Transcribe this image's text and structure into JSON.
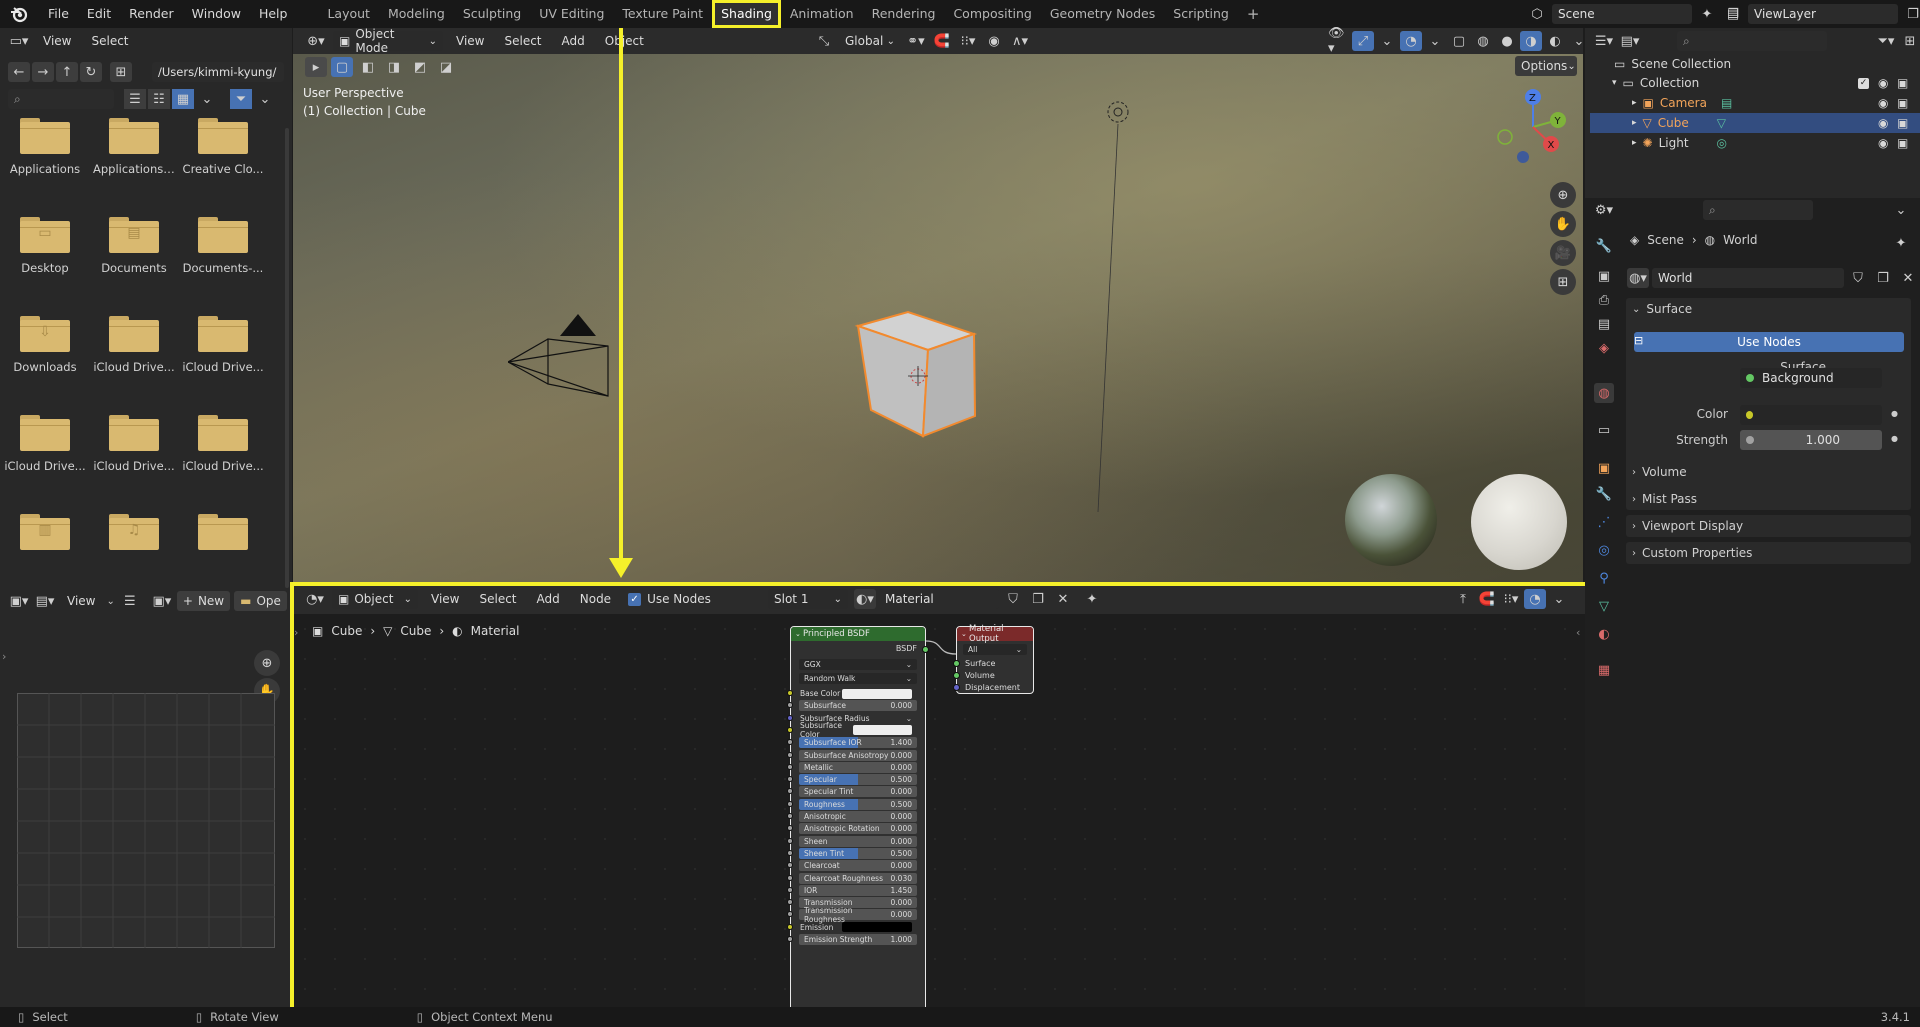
{
  "topbar": {
    "menus": [
      "File",
      "Edit",
      "Render",
      "Window",
      "Help"
    ],
    "workspaces": [
      "Layout",
      "Modeling",
      "Sculpting",
      "UV Editing",
      "Texture Paint",
      "Shading",
      "Animation",
      "Rendering",
      "Compositing",
      "Geometry Nodes",
      "Scripting"
    ],
    "active_workspace": "Shading",
    "add_tab": "+",
    "scene_name": "Scene",
    "view_layer": "ViewLayer"
  },
  "file_browser": {
    "menus": [
      "View",
      "Select"
    ],
    "path": "/Users/kimmi-kyung/",
    "items": [
      {
        "label": "Applications",
        "icon": "folder-icon"
      },
      {
        "label": "Applications ...",
        "icon": "folder-icon"
      },
      {
        "label": "Creative Clo...",
        "icon": "folder-icon"
      },
      {
        "label": "Desktop",
        "icon": "folder-desktop-icon"
      },
      {
        "label": "Documents",
        "icon": "folder-documents-icon"
      },
      {
        "label": "Documents-...",
        "icon": "folder-icon"
      },
      {
        "label": "Downloads",
        "icon": "folder-downloads-icon"
      },
      {
        "label": "iCloud Drive...",
        "icon": "folder-icon"
      },
      {
        "label": "iCloud Drive...",
        "icon": "folder-icon"
      },
      {
        "label": "iCloud Drive...",
        "icon": "folder-icon"
      },
      {
        "label": "iCloud Drive...",
        "icon": "folder-icon"
      },
      {
        "label": "iCloud Drive...",
        "icon": "folder-icon"
      },
      {
        "label": "",
        "icon": "folder-movies-icon"
      },
      {
        "label": "",
        "icon": "folder-music-icon"
      },
      {
        "label": "",
        "icon": "folder-icon"
      }
    ]
  },
  "image_editor": {
    "view": "View",
    "new": "New",
    "open": "Ope"
  },
  "viewport": {
    "mode": "Object Mode",
    "menus": [
      "View",
      "Select",
      "Add",
      "Object"
    ],
    "orientation": "Global",
    "options": "Options",
    "perspective_label": "User Perspective",
    "collection_label": "(1) Collection | Cube",
    "gizmo_axes": [
      "Z",
      "Y",
      "X"
    ]
  },
  "node_editor": {
    "type": "Object",
    "menus": [
      "View",
      "Select",
      "Add",
      "Node"
    ],
    "use_nodes": "Use Nodes",
    "slot": "Slot 1",
    "material": "Material",
    "breadcrumb": [
      "Cube",
      "Cube",
      "Material"
    ],
    "principled": {
      "title": "Principled BSDF",
      "output": "BSDF",
      "distribution": "GGX",
      "subsurface_method": "Random Walk",
      "rows": [
        {
          "label": "Base Color",
          "value": "",
          "kind": "color"
        },
        {
          "label": "Subsurface",
          "value": "0.000",
          "kind": "num"
        },
        {
          "label": "Subsurface Radius",
          "value": "",
          "kind": "vec"
        },
        {
          "label": "Subsurface Color",
          "value": "",
          "kind": "color"
        },
        {
          "label": "Subsurface IOR",
          "value": "1.400",
          "kind": "blue"
        },
        {
          "label": "Subsurface Anisotropy",
          "value": "0.000",
          "kind": "num"
        },
        {
          "label": "Metallic",
          "value": "0.000",
          "kind": "num"
        },
        {
          "label": "Specular",
          "value": "0.500",
          "kind": "blue"
        },
        {
          "label": "Specular Tint",
          "value": "0.000",
          "kind": "num"
        },
        {
          "label": "Roughness",
          "value": "0.500",
          "kind": "blue"
        },
        {
          "label": "Anisotropic",
          "value": "0.000",
          "kind": "num"
        },
        {
          "label": "Anisotropic Rotation",
          "value": "0.000",
          "kind": "num"
        },
        {
          "label": "Sheen",
          "value": "0.000",
          "kind": "num"
        },
        {
          "label": "Sheen Tint",
          "value": "0.500",
          "kind": "blue"
        },
        {
          "label": "Clearcoat",
          "value": "0.000",
          "kind": "num"
        },
        {
          "label": "Clearcoat Roughness",
          "value": "0.030",
          "kind": "num"
        },
        {
          "label": "IOR",
          "value": "1.450",
          "kind": "num"
        },
        {
          "label": "Transmission",
          "value": "0.000",
          "kind": "num"
        },
        {
          "label": "Transmission Roughness",
          "value": "0.000",
          "kind": "num"
        },
        {
          "label": "Emission",
          "value": "",
          "kind": "black"
        },
        {
          "label": "Emission Strength",
          "value": "1.000",
          "kind": "num"
        }
      ]
    },
    "output_node": {
      "title": "Material Output",
      "target": "All",
      "inputs": [
        "Surface",
        "Volume",
        "Displacement"
      ]
    }
  },
  "outliner": {
    "root": "Scene Collection",
    "collection": "Collection",
    "objects": [
      "Camera",
      "Cube",
      "Light"
    ],
    "selected": "Cube"
  },
  "properties": {
    "breadcrumb": [
      "Scene",
      "World"
    ],
    "world_name": "World",
    "surface_panel": "Surface",
    "use_nodes": "Use Nodes",
    "surface_label": "Surface",
    "surface_value": "Background",
    "color_label": "Color",
    "strength_label": "Strength",
    "strength_value": "1.000",
    "collapsed_panels": [
      "Volume",
      "Mist Pass",
      "Viewport Display",
      "Custom Properties"
    ]
  },
  "statusbar": {
    "select": "Select",
    "rotate": "Rotate View",
    "context": "Object Context Menu",
    "version": "3.4.1"
  },
  "colors": {
    "highlight_frame": "#f5f02a",
    "accent_blue": "#4772b3",
    "selected_orange": "#f28a2e",
    "folder": "#d9b970"
  }
}
